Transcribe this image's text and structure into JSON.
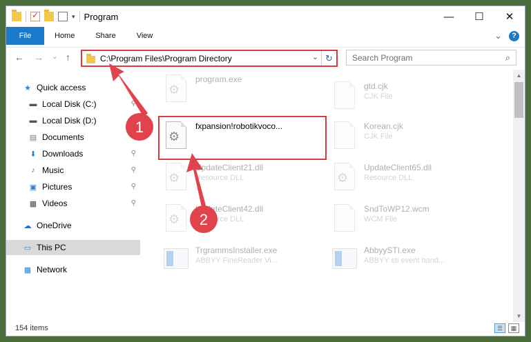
{
  "title": "Program",
  "window_controls": {
    "minimize": "—",
    "maximize": "☐",
    "close": "✕"
  },
  "ribbon": {
    "tabs": [
      "File",
      "Home",
      "Share",
      "View"
    ],
    "expand": "⌄",
    "help": "?"
  },
  "nav": {
    "back": "←",
    "forward": "→",
    "recent": "⌄",
    "up": "↑"
  },
  "address": {
    "path": "C:\\Program Files\\Program Directory",
    "dropdown": "⌄",
    "refresh": "↻"
  },
  "search": {
    "placeholder": "Search Program",
    "icon": "⌕"
  },
  "sidebar": {
    "items": [
      {
        "label": "Quick access",
        "icon": "star-icon",
        "glyph": "★",
        "color": "#2b86d6"
      },
      {
        "label": "Local Disk (C:)",
        "icon": "drive-icon",
        "glyph": "▬",
        "color": "#555555"
      },
      {
        "label": "Local Disk (D:)",
        "icon": "drive-icon",
        "glyph": "▬",
        "color": "#555555"
      },
      {
        "label": "Documents",
        "icon": "document-icon",
        "glyph": "▤",
        "color": "#6a7c8f"
      },
      {
        "label": "Downloads",
        "icon": "download-icon",
        "glyph": "⬇",
        "color": "#2b86d6"
      },
      {
        "label": "Music",
        "icon": "music-icon",
        "glyph": "♪",
        "color": "#2b86d6"
      },
      {
        "label": "Pictures",
        "icon": "pictures-icon",
        "glyph": "▣",
        "color": "#3c7fc0"
      },
      {
        "label": "Videos",
        "icon": "videos-icon",
        "glyph": "▦",
        "color": "#444444"
      },
      {
        "label": "OneDrive",
        "icon": "cloud-icon",
        "glyph": "☁",
        "color": "#1e73c8"
      },
      {
        "label": "This PC",
        "icon": "computer-icon",
        "glyph": "▭",
        "color": "#2b86d6"
      },
      {
        "label": "Network",
        "icon": "network-icon",
        "glyph": "▩",
        "color": "#2b86d6"
      }
    ],
    "pin_glyph": "📌"
  },
  "files": [
    {
      "name": "program.exe",
      "sub": "",
      "kind": "exe-gear"
    },
    {
      "name": "gtd.cjk",
      "sub": "CJK File",
      "kind": "doc"
    },
    {
      "name": "fxpansion!robotikvoco...",
      "sub": "",
      "kind": "gear"
    },
    {
      "name": "Korean.cjk",
      "sub": "CJK File",
      "kind": "doc"
    },
    {
      "name": "UpdateClient21.dll",
      "sub": "Resource DLL",
      "kind": "gear"
    },
    {
      "name": "UpdateClient65.dll",
      "sub": "Resource DLL",
      "kind": "gear"
    },
    {
      "name": "UpdateClient42.dll",
      "sub": "Resource DLL",
      "kind": "gear"
    },
    {
      "name": "SndToWP12.wcm",
      "sub": "WCM File",
      "kind": "doc"
    },
    {
      "name": "TrgrammsInstaller.exe",
      "sub": "ABBYY FineReader Vi...",
      "kind": "exe"
    },
    {
      "name": "AbbyySTI.exe",
      "sub": "ABBYY sti event hand...",
      "kind": "exe"
    }
  ],
  "status": {
    "count": "154 items"
  },
  "annotations": {
    "step1": "1",
    "step2": "2",
    "color": "#e0434b"
  }
}
